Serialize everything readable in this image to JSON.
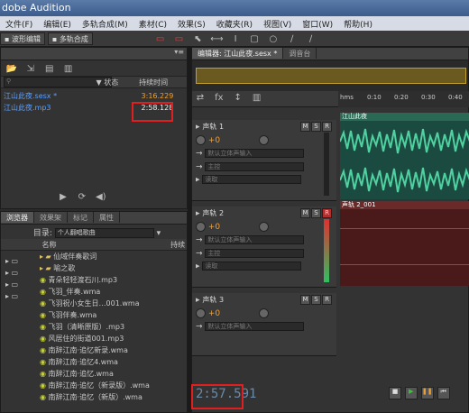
{
  "title": "dobe Audition",
  "menu": [
    "文件(F)",
    "编辑(E)",
    "多轨合成(M)",
    "素材(C)",
    "效果(S)",
    "收藏夹(R)",
    "视图(V)",
    "窗口(W)",
    "帮助(H)"
  ],
  "toolbar": {
    "waveform_tab": "波形编辑",
    "multitrack_tab": "多轨合成"
  },
  "files_panel": {
    "col_status": "状态",
    "col_duration": "持续时间",
    "items": [
      {
        "name": "江山此夜.sesx *",
        "duration": "3:16.229"
      },
      {
        "name": "江山此夜.mp3",
        "duration": "2:58.128"
      }
    ]
  },
  "browser_panel": {
    "tabs": [
      "浏览器",
      "效果架",
      "标记",
      "属性"
    ],
    "dir_label": "目录:",
    "dir_value": "个人翻唱歌曲",
    "col_name": "名称",
    "col_duration": "持续",
    "items": [
      "仙域伴奏歌词",
      "喻之歌",
      "青朵轻轻渡石川.mp3",
      "飞羽_伴奏.wma",
      "飞羽祝小女生日…001.wma",
      "飞羽伴奏.wma",
      "飞羽（清晰原版）.mp3",
      "风居住的街道001.mp3",
      "南辞江南·追忆新录.wma",
      "南辞江南·追忆4.wma",
      "南辞江南·追忆.wma",
      "南辞江南·追忆（新录版）.wma",
      "南辞江南·追忆（新版）.wma"
    ]
  },
  "editor": {
    "tabs": [
      "编辑器: 江山此夜.sesx *",
      "调音台"
    ],
    "ruler": [
      "hms",
      "0:10",
      "0:20",
      "0:30",
      "0:40"
    ],
    "tracks": [
      {
        "name": "声轨 1",
        "volume": "+0",
        "input": "默认立体声输入",
        "output": "主控",
        "read": "读取",
        "clip": "江山此夜"
      },
      {
        "name": "声轨 2",
        "volume": "+0",
        "input": "默认立体声输入",
        "output": "主控",
        "read": "读取",
        "clip": "声轨 2_001"
      },
      {
        "name": "声轨 3",
        "volume": "+0",
        "input": "默认立体声输入"
      }
    ],
    "time": "2:57.591"
  },
  "colors": {
    "accent": "#5aa0ff",
    "time": "#f0a030",
    "highlight": "#e02020",
    "wave": "#4fd1a0"
  }
}
